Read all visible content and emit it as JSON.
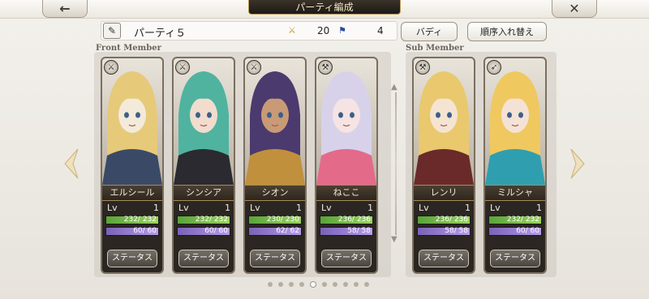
{
  "header": {
    "back_icon": "back-arrow-icon",
    "title": "パーティ編成",
    "close_icon": "close-x-icon"
  },
  "party": {
    "name": "パーティ５",
    "cost_icon_1": "sword-cost-icon",
    "cost_1": "20",
    "cost_icon_2": "flag-cost-icon",
    "cost_2": "4",
    "buddy_label": "バディ",
    "reorder_label": "順序入れ替え"
  },
  "sections": {
    "front_label": "Front Member",
    "sub_label": "Sub Member"
  },
  "members": [
    {
      "name": "エルシール",
      "weapon": "sword-icon",
      "lv_label": "Lv",
      "lv": "1",
      "hp": "232/ 232",
      "mp": "60/ 60",
      "status": "ステータス",
      "palette": [
        "#e7c97a",
        "#f3ead9",
        "#3a4a66"
      ]
    },
    {
      "name": "シンシア",
      "weapon": "sword-icon",
      "lv_label": "Lv",
      "lv": "1",
      "hp": "232/ 232",
      "mp": "60/ 60",
      "status": "ステータス",
      "palette": [
        "#4fb3a0",
        "#f1dccd",
        "#2b2a30"
      ]
    },
    {
      "name": "シオン",
      "weapon": "sword-icon",
      "lv_label": "Lv",
      "lv": "1",
      "hp": "230/ 230",
      "mp": "62/ 62",
      "status": "ステータス",
      "palette": [
        "#4b3a6e",
        "#c99a76",
        "#c0903c"
      ]
    },
    {
      "name": "ねここ",
      "weapon": "axe-icon",
      "lv_label": "Lv",
      "lv": "1",
      "hp": "236/ 236",
      "mp": "58/ 58",
      "status": "ステータス",
      "palette": [
        "#d7d2ea",
        "#f6e3e3",
        "#e46a8a"
      ]
    },
    {
      "name": "レンリ",
      "weapon": "axe-icon",
      "lv_label": "Lv",
      "lv": "1",
      "hp": "236/ 236",
      "mp": "58/ 58",
      "status": "ステータス",
      "palette": [
        "#e9c86e",
        "#f4e4d1",
        "#6a2a2a"
      ]
    },
    {
      "name": "ミルシャ",
      "weapon": "bow-icon",
      "lv_label": "Lv",
      "lv": "1",
      "hp": "232/ 232",
      "mp": "60/ 60",
      "status": "ステータス",
      "palette": [
        "#f0c860",
        "#f5e2d6",
        "#2f9fb0"
      ]
    }
  ],
  "pagination": {
    "total": 10,
    "current": 4
  },
  "nav": {
    "prev_icon": "chevron-left-icon",
    "next_icon": "chevron-right-icon"
  },
  "colors": {
    "hp_bar": "#7ec24a",
    "mp_bar": "#9a82d6",
    "card_frame": "#7b6f5e"
  }
}
